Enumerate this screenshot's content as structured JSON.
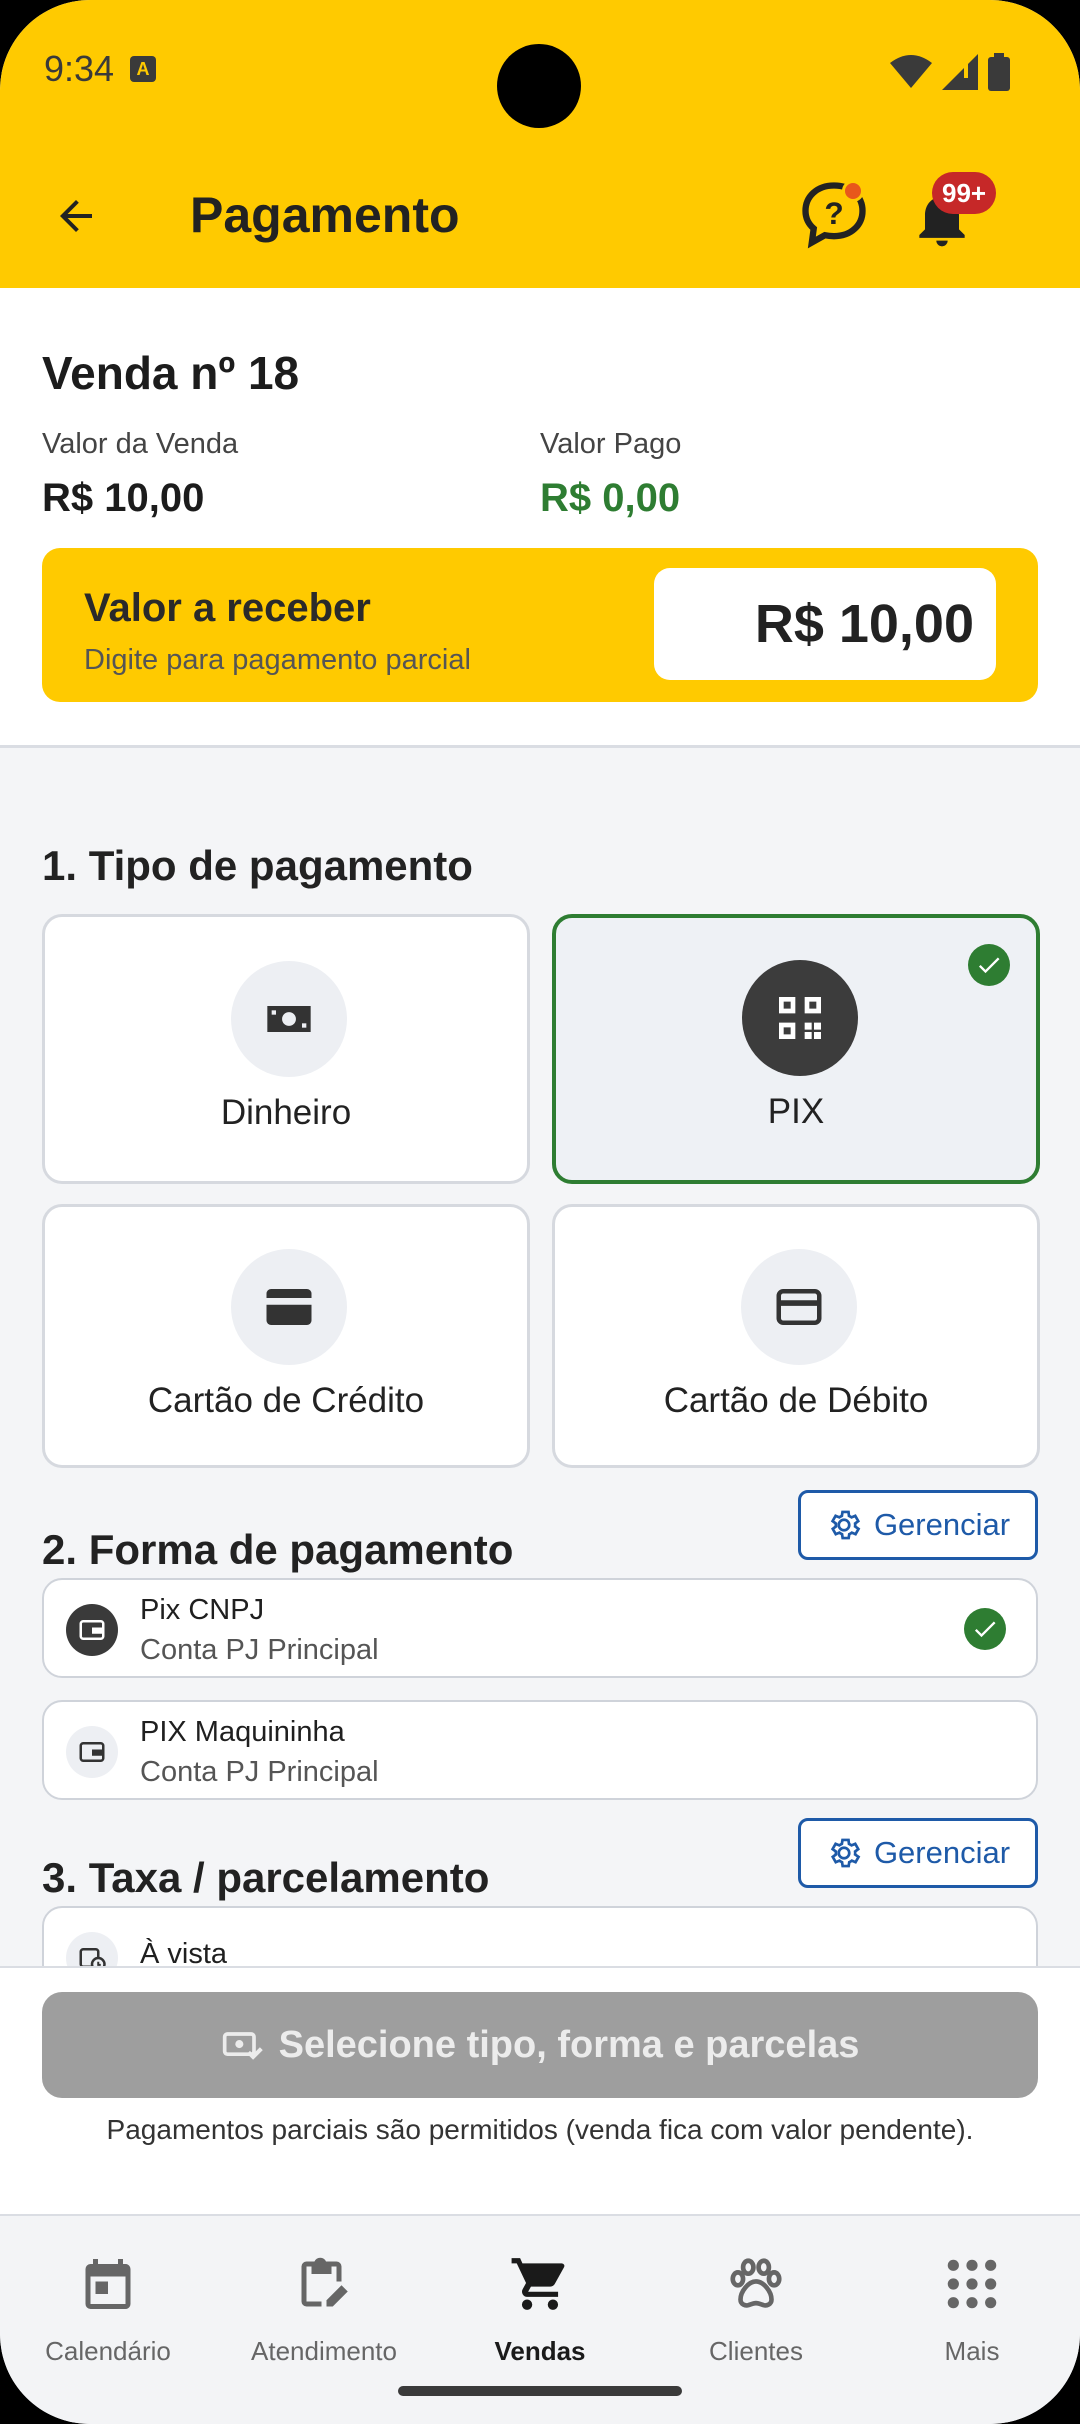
{
  "status_bar": {
    "time": "9:34",
    "notif_letter": "A"
  },
  "app_bar": {
    "title": "Pagamento",
    "badge": "99+"
  },
  "summary": {
    "sale_title": "Venda nº 18",
    "sale_value_label": "Valor da Venda",
    "sale_value": "R$ 10,00",
    "paid_label": "Valor Pago",
    "paid_value": "R$ 0,00",
    "receive_title": "Valor a receber",
    "receive_hint": "Digite para pagamento parcial",
    "receive_value": "R$ 10,00"
  },
  "section1": {
    "title": "1. Tipo de pagamento",
    "types": [
      {
        "label": "Dinheiro",
        "icon": "cash-icon",
        "selected": false
      },
      {
        "label": "PIX",
        "icon": "qr-code-icon",
        "selected": true
      },
      {
        "label": "Cartão de Crédito",
        "icon": "credit-card-icon",
        "selected": false
      },
      {
        "label": "Cartão de Débito",
        "icon": "debit-card-icon",
        "selected": false
      }
    ]
  },
  "section2": {
    "title": "2. Forma de pagamento",
    "manage_label": "Gerenciar",
    "methods": [
      {
        "name": "Pix CNPJ",
        "sub": "Conta PJ Principal",
        "selected": true
      },
      {
        "name": "PIX Maquininha",
        "sub": "Conta PJ Principal",
        "selected": false
      }
    ]
  },
  "section3": {
    "title": "3. Taxa / parcelamento",
    "manage_label": "Gerenciar",
    "options": [
      {
        "name": "À vista"
      }
    ]
  },
  "footer": {
    "button_label": "Selecione tipo, forma e parcelas",
    "note": "Pagamentos parciais são permitidos (venda fica com valor pendente)."
  },
  "bottom_nav": [
    {
      "label": "Calendário",
      "icon": "calendar-icon",
      "active": false
    },
    {
      "label": "Atendimento",
      "icon": "clipboard-edit-icon",
      "active": false
    },
    {
      "label": "Vendas",
      "icon": "cart-icon",
      "active": true
    },
    {
      "label": "Clientes",
      "icon": "paw-icon",
      "active": false
    },
    {
      "label": "Mais",
      "icon": "apps-grid-icon",
      "active": false
    }
  ],
  "colors": {
    "brand": "#FFCA00",
    "success": "#2E7D32",
    "paid_green": "#2E7D32",
    "link_blue": "#1E5AA8",
    "badge_red": "#C62828"
  }
}
